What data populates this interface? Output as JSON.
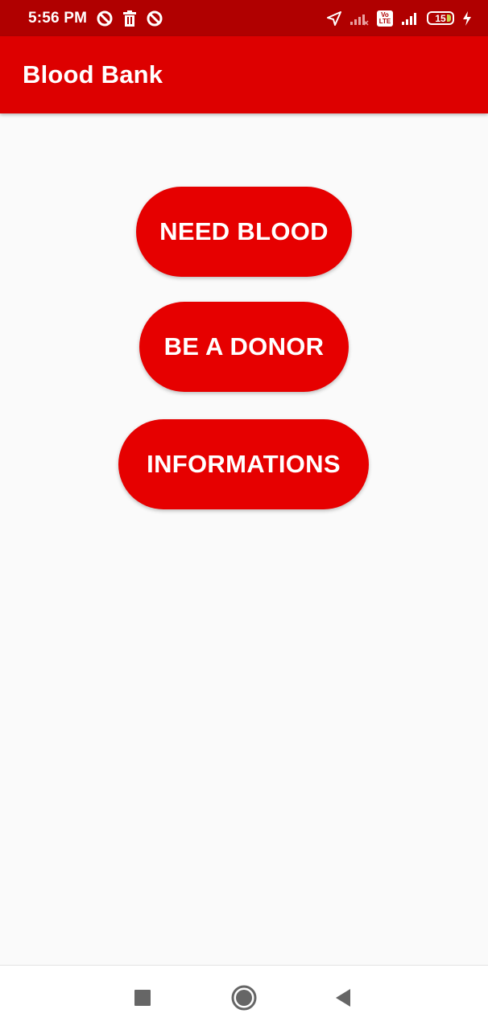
{
  "status_bar": {
    "time": "5:56 PM",
    "volte_top": "Vo",
    "volte_bottom": "LTE",
    "battery_level": "15",
    "colors": {
      "background": "#b00000",
      "icon": "#ffffff"
    },
    "left_icons": [
      "sync-blocked-icon",
      "trash-icon",
      "sync-blocked-icon"
    ],
    "right_icons": [
      "location-arrow-icon",
      "signal-no-service-icon",
      "volte-icon",
      "signal-icon",
      "battery-icon",
      "charging-bolt-icon"
    ]
  },
  "app_bar": {
    "title": "Blood Bank",
    "color": "#dd0000"
  },
  "main": {
    "buttons": [
      {
        "label": "NEED BLOOD"
      },
      {
        "label": "BE A DONOR"
      },
      {
        "label": "INFORMATIONS"
      }
    ],
    "button_color": "#e60000",
    "background": "#fafafa"
  },
  "nav_bar": {
    "icons": [
      "recents-square-icon",
      "home-circle-icon",
      "back-triangle-icon"
    ]
  }
}
